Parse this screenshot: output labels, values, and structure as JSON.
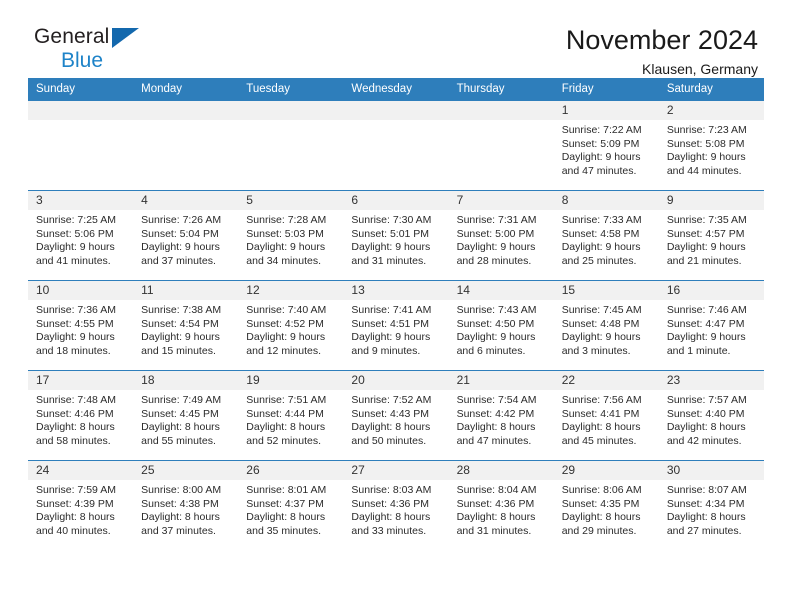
{
  "brand": {
    "name_part1": "General",
    "name_part2": "Blue",
    "triangle_color": "#1368ad",
    "blue_color": "#1e83c8"
  },
  "header": {
    "title": "November 2024",
    "subtitle": "Klausen, Germany",
    "header_bg": "#2e7ebb"
  },
  "weekdays": [
    "Sunday",
    "Monday",
    "Tuesday",
    "Wednesday",
    "Thursday",
    "Friday",
    "Saturday"
  ],
  "weeks": [
    [
      {
        "day": "",
        "empty": true,
        "sunrise": "",
        "sunset": "",
        "daylight1": "",
        "daylight2": ""
      },
      {
        "day": "",
        "empty": true,
        "sunrise": "",
        "sunset": "",
        "daylight1": "",
        "daylight2": ""
      },
      {
        "day": "",
        "empty": true,
        "sunrise": "",
        "sunset": "",
        "daylight1": "",
        "daylight2": ""
      },
      {
        "day": "",
        "empty": true,
        "sunrise": "",
        "sunset": "",
        "daylight1": "",
        "daylight2": ""
      },
      {
        "day": "",
        "empty": true,
        "sunrise": "",
        "sunset": "",
        "daylight1": "",
        "daylight2": ""
      },
      {
        "day": "1",
        "empty": false,
        "sunrise": "Sunrise: 7:22 AM",
        "sunset": "Sunset: 5:09 PM",
        "daylight1": "Daylight: 9 hours",
        "daylight2": "and 47 minutes."
      },
      {
        "day": "2",
        "empty": false,
        "sunrise": "Sunrise: 7:23 AM",
        "sunset": "Sunset: 5:08 PM",
        "daylight1": "Daylight: 9 hours",
        "daylight2": "and 44 minutes."
      }
    ],
    [
      {
        "day": "3",
        "empty": false,
        "sunrise": "Sunrise: 7:25 AM",
        "sunset": "Sunset: 5:06 PM",
        "daylight1": "Daylight: 9 hours",
        "daylight2": "and 41 minutes."
      },
      {
        "day": "4",
        "empty": false,
        "sunrise": "Sunrise: 7:26 AM",
        "sunset": "Sunset: 5:04 PM",
        "daylight1": "Daylight: 9 hours",
        "daylight2": "and 37 minutes."
      },
      {
        "day": "5",
        "empty": false,
        "sunrise": "Sunrise: 7:28 AM",
        "sunset": "Sunset: 5:03 PM",
        "daylight1": "Daylight: 9 hours",
        "daylight2": "and 34 minutes."
      },
      {
        "day": "6",
        "empty": false,
        "sunrise": "Sunrise: 7:30 AM",
        "sunset": "Sunset: 5:01 PM",
        "daylight1": "Daylight: 9 hours",
        "daylight2": "and 31 minutes."
      },
      {
        "day": "7",
        "empty": false,
        "sunrise": "Sunrise: 7:31 AM",
        "sunset": "Sunset: 5:00 PM",
        "daylight1": "Daylight: 9 hours",
        "daylight2": "and 28 minutes."
      },
      {
        "day": "8",
        "empty": false,
        "sunrise": "Sunrise: 7:33 AM",
        "sunset": "Sunset: 4:58 PM",
        "daylight1": "Daylight: 9 hours",
        "daylight2": "and 25 minutes."
      },
      {
        "day": "9",
        "empty": false,
        "sunrise": "Sunrise: 7:35 AM",
        "sunset": "Sunset: 4:57 PM",
        "daylight1": "Daylight: 9 hours",
        "daylight2": "and 21 minutes."
      }
    ],
    [
      {
        "day": "10",
        "empty": false,
        "sunrise": "Sunrise: 7:36 AM",
        "sunset": "Sunset: 4:55 PM",
        "daylight1": "Daylight: 9 hours",
        "daylight2": "and 18 minutes."
      },
      {
        "day": "11",
        "empty": false,
        "sunrise": "Sunrise: 7:38 AM",
        "sunset": "Sunset: 4:54 PM",
        "daylight1": "Daylight: 9 hours",
        "daylight2": "and 15 minutes."
      },
      {
        "day": "12",
        "empty": false,
        "sunrise": "Sunrise: 7:40 AM",
        "sunset": "Sunset: 4:52 PM",
        "daylight1": "Daylight: 9 hours",
        "daylight2": "and 12 minutes."
      },
      {
        "day": "13",
        "empty": false,
        "sunrise": "Sunrise: 7:41 AM",
        "sunset": "Sunset: 4:51 PM",
        "daylight1": "Daylight: 9 hours",
        "daylight2": "and 9 minutes."
      },
      {
        "day": "14",
        "empty": false,
        "sunrise": "Sunrise: 7:43 AM",
        "sunset": "Sunset: 4:50 PM",
        "daylight1": "Daylight: 9 hours",
        "daylight2": "and 6 minutes."
      },
      {
        "day": "15",
        "empty": false,
        "sunrise": "Sunrise: 7:45 AM",
        "sunset": "Sunset: 4:48 PM",
        "daylight1": "Daylight: 9 hours",
        "daylight2": "and 3 minutes."
      },
      {
        "day": "16",
        "empty": false,
        "sunrise": "Sunrise: 7:46 AM",
        "sunset": "Sunset: 4:47 PM",
        "daylight1": "Daylight: 9 hours",
        "daylight2": "and 1 minute."
      }
    ],
    [
      {
        "day": "17",
        "empty": false,
        "sunrise": "Sunrise: 7:48 AM",
        "sunset": "Sunset: 4:46 PM",
        "daylight1": "Daylight: 8 hours",
        "daylight2": "and 58 minutes."
      },
      {
        "day": "18",
        "empty": false,
        "sunrise": "Sunrise: 7:49 AM",
        "sunset": "Sunset: 4:45 PM",
        "daylight1": "Daylight: 8 hours",
        "daylight2": "and 55 minutes."
      },
      {
        "day": "19",
        "empty": false,
        "sunrise": "Sunrise: 7:51 AM",
        "sunset": "Sunset: 4:44 PM",
        "daylight1": "Daylight: 8 hours",
        "daylight2": "and 52 minutes."
      },
      {
        "day": "20",
        "empty": false,
        "sunrise": "Sunrise: 7:52 AM",
        "sunset": "Sunset: 4:43 PM",
        "daylight1": "Daylight: 8 hours",
        "daylight2": "and 50 minutes."
      },
      {
        "day": "21",
        "empty": false,
        "sunrise": "Sunrise: 7:54 AM",
        "sunset": "Sunset: 4:42 PM",
        "daylight1": "Daylight: 8 hours",
        "daylight2": "and 47 minutes."
      },
      {
        "day": "22",
        "empty": false,
        "sunrise": "Sunrise: 7:56 AM",
        "sunset": "Sunset: 4:41 PM",
        "daylight1": "Daylight: 8 hours",
        "daylight2": "and 45 minutes."
      },
      {
        "day": "23",
        "empty": false,
        "sunrise": "Sunrise: 7:57 AM",
        "sunset": "Sunset: 4:40 PM",
        "daylight1": "Daylight: 8 hours",
        "daylight2": "and 42 minutes."
      }
    ],
    [
      {
        "day": "24",
        "empty": false,
        "sunrise": "Sunrise: 7:59 AM",
        "sunset": "Sunset: 4:39 PM",
        "daylight1": "Daylight: 8 hours",
        "daylight2": "and 40 minutes."
      },
      {
        "day": "25",
        "empty": false,
        "sunrise": "Sunrise: 8:00 AM",
        "sunset": "Sunset: 4:38 PM",
        "daylight1": "Daylight: 8 hours",
        "daylight2": "and 37 minutes."
      },
      {
        "day": "26",
        "empty": false,
        "sunrise": "Sunrise: 8:01 AM",
        "sunset": "Sunset: 4:37 PM",
        "daylight1": "Daylight: 8 hours",
        "daylight2": "and 35 minutes."
      },
      {
        "day": "27",
        "empty": false,
        "sunrise": "Sunrise: 8:03 AM",
        "sunset": "Sunset: 4:36 PM",
        "daylight1": "Daylight: 8 hours",
        "daylight2": "and 33 minutes."
      },
      {
        "day": "28",
        "empty": false,
        "sunrise": "Sunrise: 8:04 AM",
        "sunset": "Sunset: 4:36 PM",
        "daylight1": "Daylight: 8 hours",
        "daylight2": "and 31 minutes."
      },
      {
        "day": "29",
        "empty": false,
        "sunrise": "Sunrise: 8:06 AM",
        "sunset": "Sunset: 4:35 PM",
        "daylight1": "Daylight: 8 hours",
        "daylight2": "and 29 minutes."
      },
      {
        "day": "30",
        "empty": false,
        "sunrise": "Sunrise: 8:07 AM",
        "sunset": "Sunset: 4:34 PM",
        "daylight1": "Daylight: 8 hours",
        "daylight2": "and 27 minutes."
      }
    ]
  ]
}
